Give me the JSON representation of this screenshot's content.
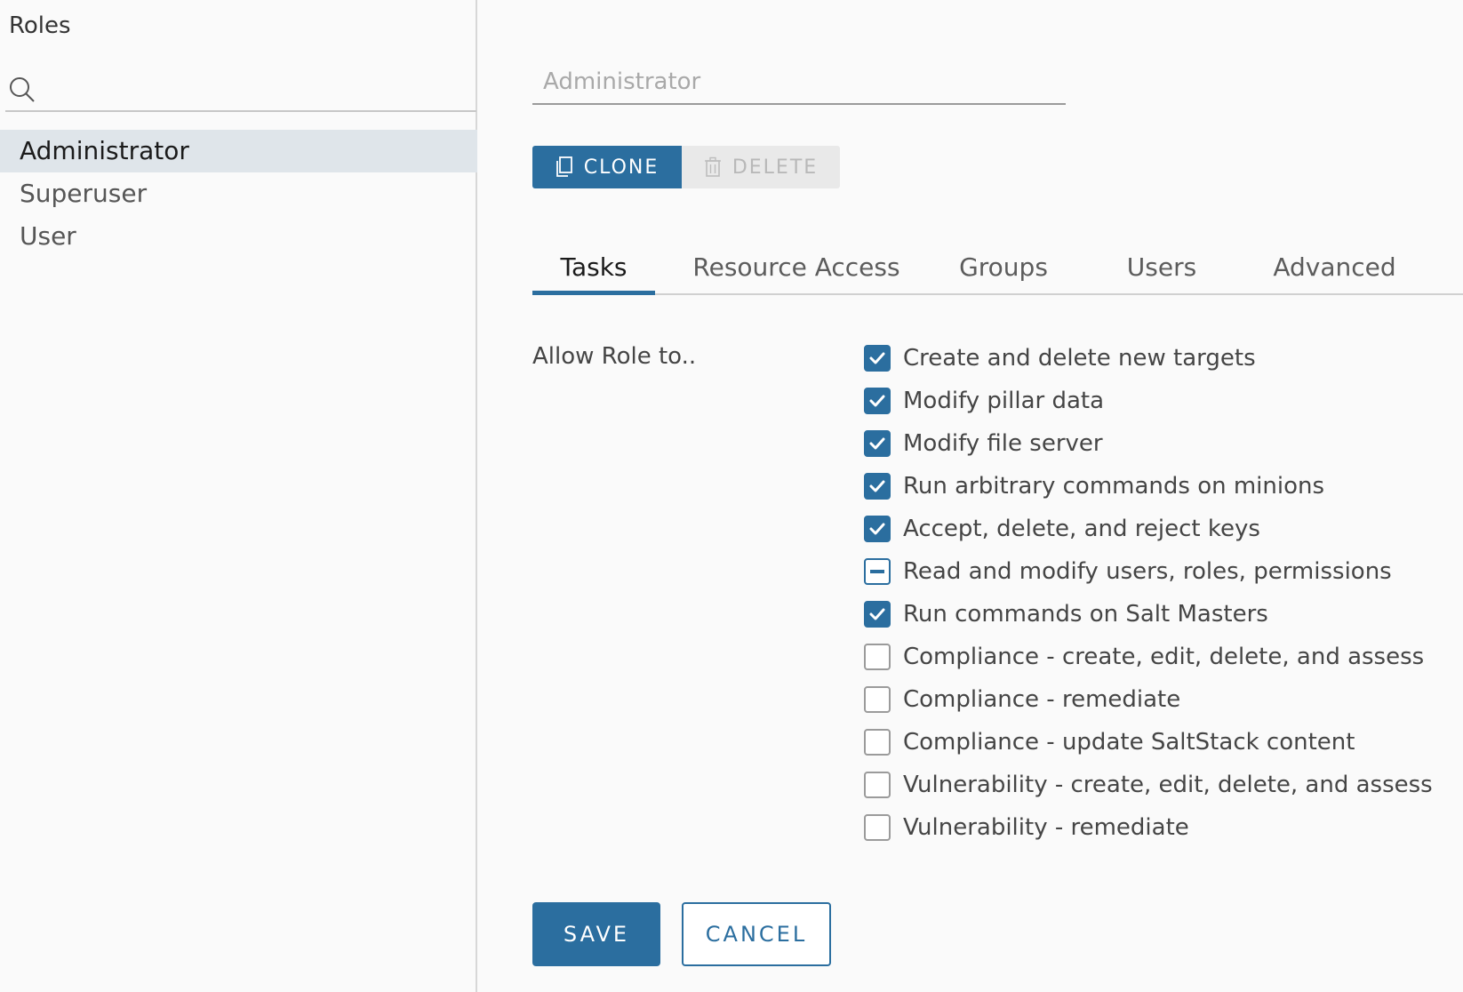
{
  "sidebar": {
    "title": "Roles",
    "search": {
      "value": "",
      "placeholder": ""
    },
    "roles": [
      {
        "label": "Administrator",
        "selected": true
      },
      {
        "label": "Superuser",
        "selected": false
      },
      {
        "label": "User",
        "selected": false
      }
    ]
  },
  "main": {
    "role_name": {
      "value": "",
      "placeholder": "Administrator"
    },
    "actions": {
      "clone_label": "CLONE",
      "delete_label": "DELETE"
    },
    "tabs": [
      {
        "label": "Tasks",
        "active": true
      },
      {
        "label": "Resource Access",
        "active": false
      },
      {
        "label": "Groups",
        "active": false
      },
      {
        "label": "Users",
        "active": false
      },
      {
        "label": "Advanced",
        "active": false
      }
    ],
    "allow_label": "Allow Role to..",
    "tasks": [
      {
        "label": "Create and delete new targets",
        "state": "checked"
      },
      {
        "label": "Modify pillar data",
        "state": "checked"
      },
      {
        "label": "Modify file server",
        "state": "checked"
      },
      {
        "label": "Run arbitrary commands on minions",
        "state": "checked"
      },
      {
        "label": "Accept, delete, and reject keys",
        "state": "checked"
      },
      {
        "label": "Read and modify users, roles, permissions",
        "state": "indeterminate"
      },
      {
        "label": "Run commands on Salt Masters",
        "state": "checked"
      },
      {
        "label": "Compliance - create, edit, delete, and assess",
        "state": "unchecked"
      },
      {
        "label": "Compliance - remediate",
        "state": "unchecked"
      },
      {
        "label": "Compliance - update SaltStack content",
        "state": "unchecked"
      },
      {
        "label": "Vulnerability - create, edit, delete, and assess",
        "state": "unchecked"
      },
      {
        "label": "Vulnerability - remediate",
        "state": "unchecked"
      }
    ],
    "footer": {
      "save_label": "SAVE",
      "cancel_label": "CANCEL"
    }
  },
  "colors": {
    "accent": "#2b6e9f",
    "selected_row": "#dfe5ea",
    "disabled_button": "#e9e9e9"
  }
}
